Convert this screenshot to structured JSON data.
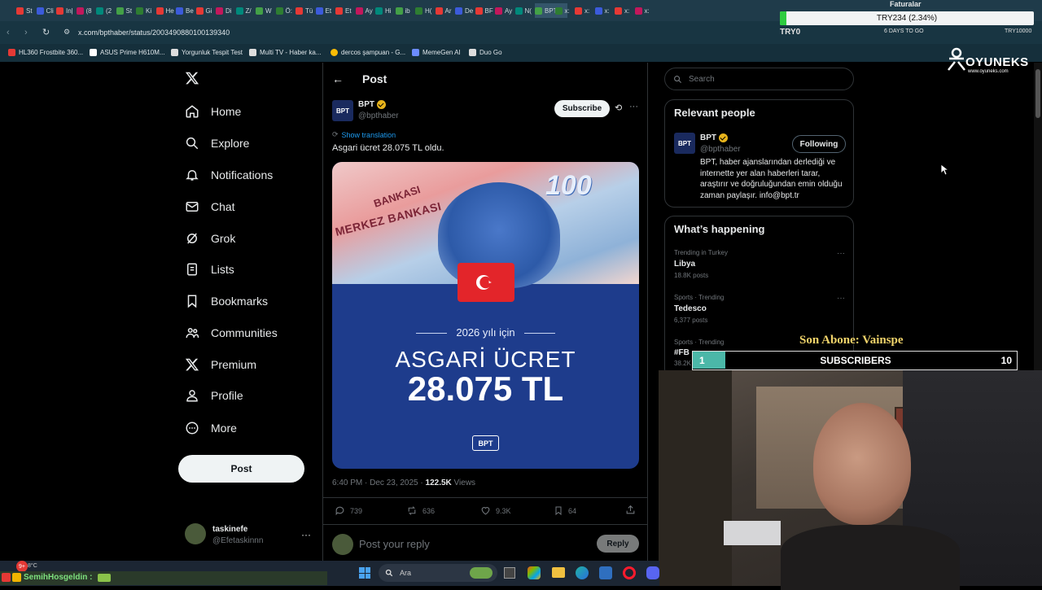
{
  "browser": {
    "tabs": [
      "St",
      "Cli",
      "In|",
      "(8",
      "(2",
      "St",
      "Ki",
      "He",
      "Be",
      "Gi",
      "Di",
      "Z/",
      "W",
      "Ö:",
      "Tü",
      "Et",
      "Et",
      "Ay",
      "Hi",
      "ib",
      "H(",
      "Ar",
      "De",
      "BF",
      "Ay",
      "N(",
      "BPT",
      "x:",
      "x:",
      "x:",
      "x:",
      "x:"
    ],
    "address": "x.com/bpthaber/status/2003490880100139340",
    "ext_try": "TRY0",
    "ext_days": "6 DAYS TO GO",
    "ext_right": "TRY10000",
    "bookmarks": [
      "HL360 Frostbite 360...",
      "ASUS Prime H610M...",
      "Yorgunluk Tespit Test",
      "Multi TV - Haber ka...",
      "dercos şampuan - G...",
      "MemeGen AI",
      "Duo Go"
    ]
  },
  "overlay": {
    "faturalar": "Faturalar",
    "ticker": "TRY234 (2.34%)",
    "brand": "OYUNEKS",
    "brand_url": "www.oyuneks.com",
    "last_sub": "Son Abone: Vainspe",
    "sub_label": "SUBSCRIBERS",
    "sub_current": "1",
    "sub_goal": "10",
    "sub_fraction": 0.1
  },
  "nav": {
    "items": [
      "Home",
      "Explore",
      "Notifications",
      "Chat",
      "Grok",
      "Lists",
      "Bookmarks",
      "Communities",
      "Premium",
      "Profile",
      "More"
    ],
    "post_button": "Post",
    "user_name": "taskinefe",
    "user_handle": "@Efetaskinnn"
  },
  "post": {
    "header_title": "Post",
    "author_name": "BPT",
    "author_handle": "@bpthaber",
    "subscribe": "Subscribe",
    "show_translation": "Show translation",
    "text": "Asgari ücret 28.075 TL oldu.",
    "image": {
      "banknote_value": "100",
      "bank_name_1": "MERKEZ BANKASI",
      "bank_name_2": "BANKASI",
      "year_line": "2026 yılı için",
      "headline": "ASGARİ ÜCRET",
      "amount": "28.075 TL",
      "logo": "BPT"
    },
    "timestamp": "6:40 PM · Dec 23, 2025 · ",
    "views_count": "122.5K",
    "views_label": "Views",
    "stats": {
      "replies": "739",
      "reposts": "636",
      "likes": "9.3K",
      "bookmarks": "64"
    },
    "reply_placeholder": "Post your reply",
    "reply_button": "Reply",
    "logo_text": "BPT"
  },
  "sidebar": {
    "search_placeholder": "Search",
    "relevant_title": "Relevant people",
    "person_name": "BPT",
    "person_handle": "@bpthaber",
    "following": "Following",
    "person_bio": "BPT, haber ajanslarından derlediği ve internette yer alan haberleri tarar, araştırır ve doğruluğundan emin olduğu zaman paylaşır. info@bpt.tr",
    "happening_title": "What’s happening",
    "trends": [
      {
        "context": "Trending in Turkey",
        "name": "Libya",
        "posts": "18.8K posts"
      },
      {
        "context": "Sports · Trending",
        "name": "Tedesco",
        "posts": "6,377 posts"
      },
      {
        "context": "Sports · Trending",
        "name": "#FB",
        "posts": "38.2K"
      }
    ]
  },
  "taskbar": {
    "search": "Ara",
    "badge": "9+",
    "temp": "8°C",
    "chat_line": "SemihHosgeldin :"
  }
}
